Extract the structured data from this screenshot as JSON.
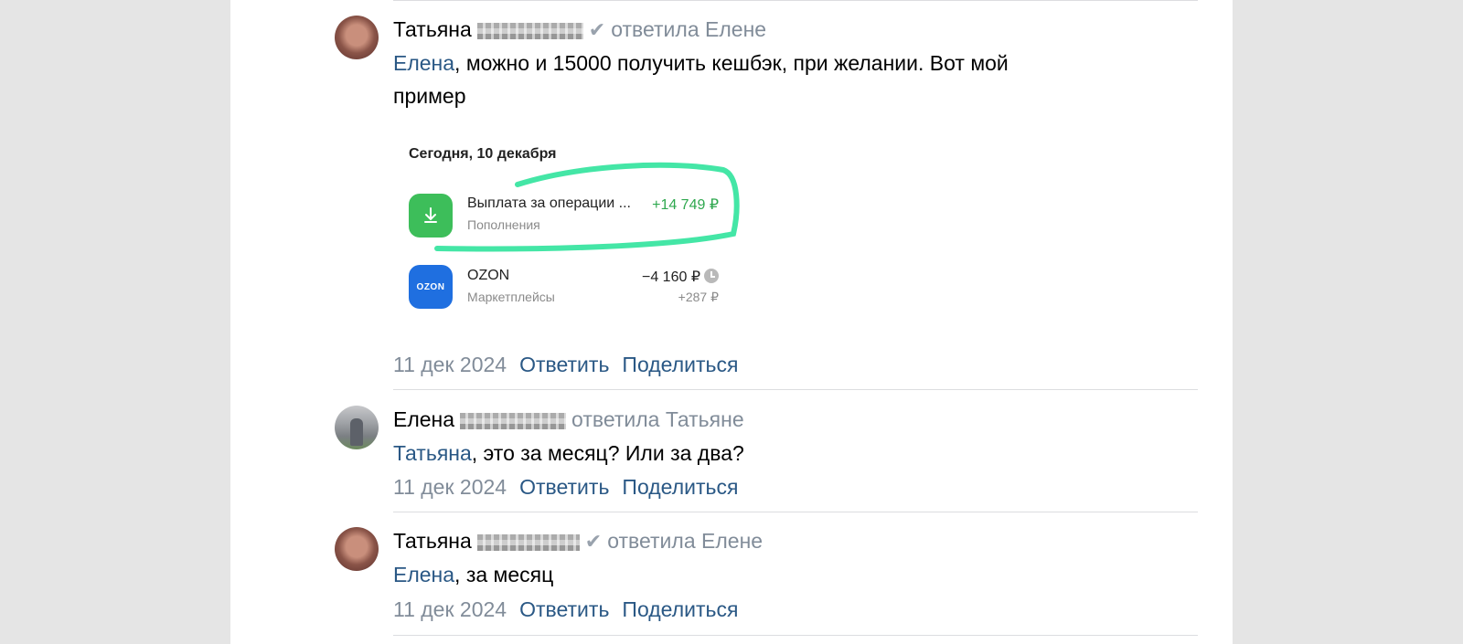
{
  "comments": [
    {
      "author": "Татьяна",
      "reply_to": "ответила Елене",
      "mention": "Елена",
      "text_line1": ", можно и 15000 получить кешбэк, при желании. Вот мой",
      "text_line2": "пример",
      "date": "11 дек 2024",
      "reply_label": "Ответить",
      "share_label": "Поделиться",
      "attachment": {
        "date_header": "Сегодня, 10 декабря",
        "transactions": [
          {
            "title": "Выплата за операции ...",
            "category": "Пополнения",
            "amount": "+14 749 ₽",
            "icon": "download-icon",
            "color": "#3dbe5a",
            "amount_color": "#2fa84f"
          },
          {
            "title": "OZON",
            "category": "Маркетплейсы",
            "amount": "−4 160 ₽",
            "cashback": "+287 ₽",
            "icon_text": "OZON",
            "icon": "ozon-logo",
            "color": "#1f6fe0"
          }
        ],
        "highlight_color": "#44e6a6"
      }
    },
    {
      "author": "Елена",
      "reply_to": "ответила Татьяне",
      "mention": "Татьяна",
      "text": ", это за месяц? Или за два?",
      "date": "11 дек 2024",
      "reply_label": "Ответить",
      "share_label": "Поделиться"
    },
    {
      "author": "Татьяна",
      "reply_to": "ответила Елене",
      "mention": "Елена",
      "text": ", за месяц",
      "date": "11 дек 2024",
      "reply_label": "Ответить",
      "share_label": "Поделиться"
    }
  ],
  "colors": {
    "link": "#2a5885",
    "secondary": "#818c99",
    "background": "#e5e5e5"
  }
}
